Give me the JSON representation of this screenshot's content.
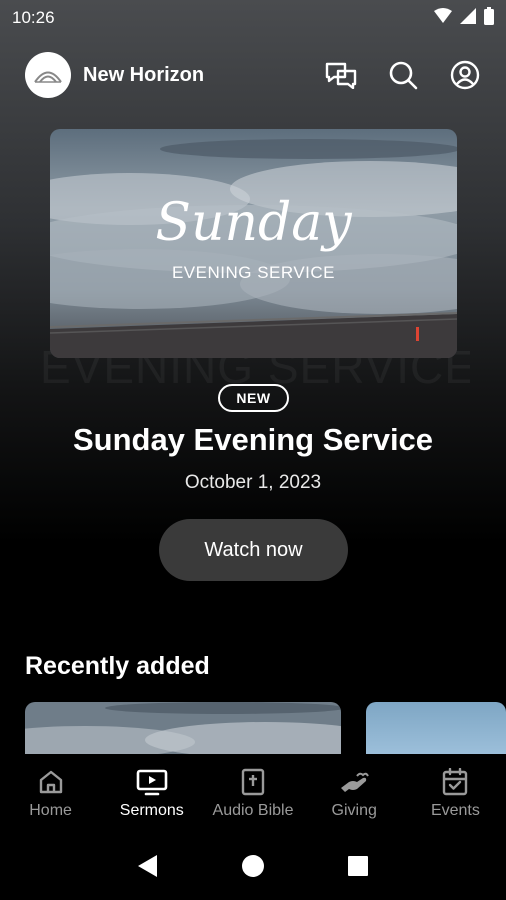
{
  "status_bar": {
    "time": "10:26",
    "icons": [
      "wifi-icon",
      "signal-icon",
      "battery-icon"
    ]
  },
  "header": {
    "app_name": "New Horizon",
    "actions": [
      "chat-icon",
      "search-icon",
      "account-icon"
    ]
  },
  "hero": {
    "image_title": "Sunday",
    "image_subtitle": "EVENING SERVICE",
    "background_text": "EVENING SERVICE",
    "badge": "NEW",
    "title": "Sunday Evening Service",
    "date": "October 1, 2023",
    "cta_label": "Watch now"
  },
  "recent": {
    "title": "Recently added"
  },
  "bottom_nav": {
    "items": [
      {
        "label": "Home",
        "icon": "home-icon",
        "active": false
      },
      {
        "label": "Sermons",
        "icon": "tv-play-icon",
        "active": true
      },
      {
        "label": "Audio Bible",
        "icon": "bible-icon",
        "active": false
      },
      {
        "label": "Giving",
        "icon": "hand-heart-icon",
        "active": false
      },
      {
        "label": "Events",
        "icon": "calendar-icon",
        "active": false
      }
    ]
  },
  "system_nav": [
    "back-icon",
    "home-circle-icon",
    "recents-icon"
  ],
  "colors": {
    "background": "#000000",
    "button": "#3a3a3a",
    "nav_inactive": "#9a9a9a",
    "nav_active": "#ffffff"
  }
}
